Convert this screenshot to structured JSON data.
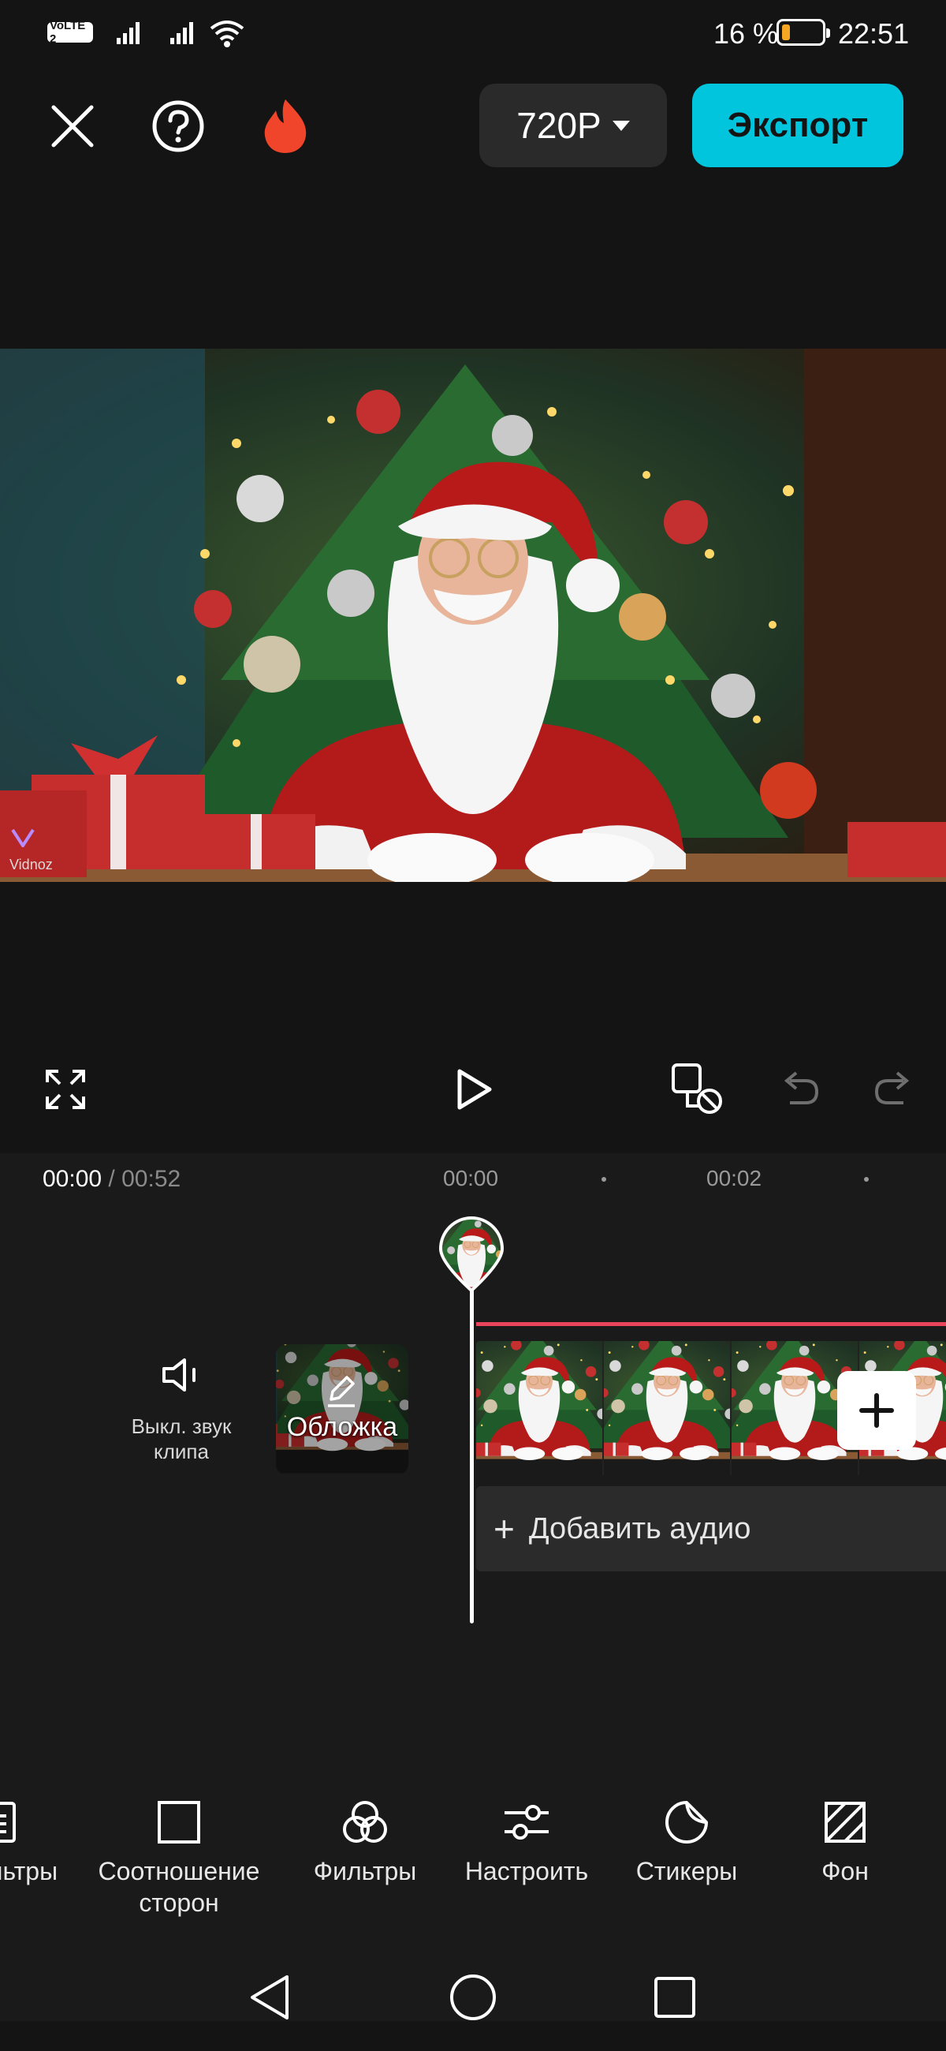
{
  "status_bar": {
    "volte": "VoLTE 2",
    "battery_percent": "16 %",
    "time": "22:51",
    "battery_color": "#f5a623"
  },
  "toolbar": {
    "close_icon": "close-icon",
    "help_icon": "help-icon",
    "promo_icon": "flame-icon",
    "resolution_label": "720P",
    "export_label": "Экспорт",
    "accent_color": "#00c5dd"
  },
  "preview": {
    "watermark": "Vidnoz"
  },
  "controls": {
    "fullscreen_icon": "fullscreen-icon",
    "play_icon": "play-icon",
    "keyframe_icon": "keyframe-icon",
    "undo_icon": "undo-icon",
    "redo_icon": "redo-icon"
  },
  "timeline": {
    "current_time": "00:00",
    "separator": "/",
    "total_time": "00:52",
    "ruler_labels": [
      "00:00",
      "00:02"
    ],
    "mute_label": "Выкл. звук клипа",
    "cover_label": "Обложка",
    "add_audio_label": "Добавить аудио",
    "track_color": "#e8455c"
  },
  "tools": [
    {
      "label": "ильтры",
      "icon": "text-template-icon"
    },
    {
      "label": "Соотношение сторон",
      "icon": "aspect-ratio-icon"
    },
    {
      "label": "Фильтры",
      "icon": "filters-icon"
    },
    {
      "label": "Настроить",
      "icon": "adjust-icon"
    },
    {
      "label": "Стикеры",
      "icon": "stickers-icon"
    },
    {
      "label": "Фон",
      "icon": "background-icon"
    }
  ],
  "nav": {
    "back_icon": "nav-back-icon",
    "home_icon": "nav-home-icon",
    "recents_icon": "nav-recents-icon"
  }
}
